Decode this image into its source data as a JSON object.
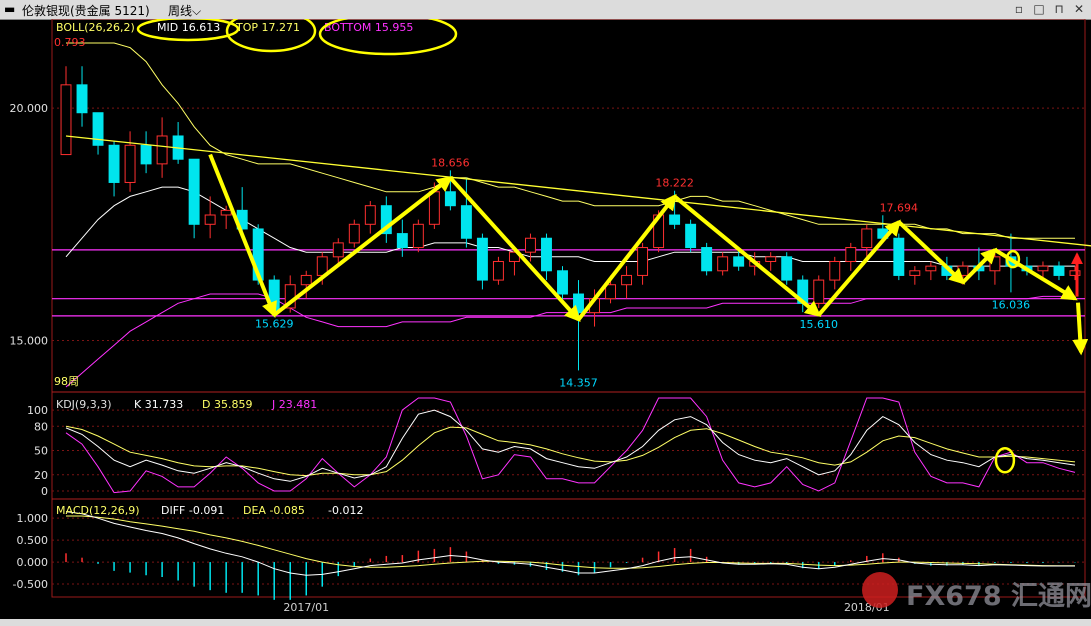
{
  "window": {
    "title": "伦敦银现(贵金属 5121)",
    "period": "周线"
  },
  "watermark": {
    "text": "FX678 汇通网"
  },
  "chart_data": {
    "type": "candlestick",
    "main": {
      "indicator_label": "BOLL(26,26,2)",
      "mid_label": "MID 16.613",
      "top_label": "TOP 17.271",
      "bottom_label": "BOTTOM 15.955",
      "y_ticks": [
        "20.000",
        "15.000"
      ],
      "y_tick_values": [
        20,
        15
      ],
      "y_range": [
        14.0,
        21.4
      ],
      "count_label": "98周",
      "edge_value": "0.793",
      "annotations": [
        {
          "text": "15.629",
          "x": 13,
          "y": 15.629,
          "side": "below",
          "color": "#00d8ff"
        },
        {
          "text": "18.656",
          "x": 24,
          "y": 18.656,
          "side": "above",
          "color": "#ff3030"
        },
        {
          "text": "14.357",
          "x": 32,
          "y": 14.357,
          "side": "below",
          "color": "#00d8ff"
        },
        {
          "text": "18.222",
          "x": 38,
          "y": 18.222,
          "side": "above",
          "color": "#ff3030"
        },
        {
          "text": "15.610",
          "x": 47,
          "y": 15.61,
          "side": "below",
          "color": "#00d8ff"
        },
        {
          "text": "17.694",
          "x": 52,
          "y": 17.694,
          "side": "above",
          "color": "#ff3030"
        },
        {
          "text": "16.036",
          "x": 59,
          "y": 16.036,
          "side": "below",
          "color": "#00d8ff"
        }
      ],
      "candles": [
        [
          19.0,
          20.9,
          19.0,
          20.5
        ],
        [
          20.5,
          20.9,
          19.6,
          19.9
        ],
        [
          19.9,
          19.9,
          19.0,
          19.2
        ],
        [
          19.2,
          19.3,
          18.1,
          18.4
        ],
        [
          18.4,
          19.5,
          18.2,
          19.2
        ],
        [
          19.2,
          19.5,
          18.6,
          18.8
        ],
        [
          18.8,
          19.8,
          18.5,
          19.4
        ],
        [
          19.4,
          19.7,
          18.8,
          18.9
        ],
        [
          18.9,
          18.9,
          17.2,
          17.5
        ],
        [
          17.5,
          18.1,
          17.2,
          17.7
        ],
        [
          17.7,
          17.9,
          17.4,
          17.8
        ],
        [
          17.8,
          18.3,
          17.2,
          17.4
        ],
        [
          17.4,
          17.5,
          16.2,
          16.3
        ],
        [
          16.3,
          16.4,
          15.5,
          15.63
        ],
        [
          15.7,
          16.4,
          15.6,
          16.2
        ],
        [
          16.2,
          16.5,
          15.9,
          16.4
        ],
        [
          16.4,
          16.9,
          16.2,
          16.8
        ],
        [
          16.8,
          17.2,
          16.6,
          17.1
        ],
        [
          17.1,
          17.6,
          17.0,
          17.5
        ],
        [
          17.5,
          18.0,
          17.3,
          17.9
        ],
        [
          17.9,
          18.1,
          17.1,
          17.3
        ],
        [
          17.3,
          17.6,
          16.8,
          17.0
        ],
        [
          17.0,
          17.6,
          16.9,
          17.5
        ],
        [
          17.5,
          18.4,
          17.4,
          18.2
        ],
        [
          18.2,
          18.66,
          17.8,
          17.9
        ],
        [
          17.9,
          18.5,
          17.0,
          17.2
        ],
        [
          17.2,
          17.3,
          16.1,
          16.3
        ],
        [
          16.3,
          16.8,
          16.2,
          16.7
        ],
        [
          16.7,
          17.0,
          16.4,
          16.9
        ],
        [
          16.9,
          17.3,
          16.7,
          17.2
        ],
        [
          17.2,
          17.3,
          16.3,
          16.5
        ],
        [
          16.5,
          16.6,
          15.8,
          16.0
        ],
        [
          16.0,
          16.3,
          14.357,
          15.6
        ],
        [
          15.6,
          16.1,
          15.3,
          15.9
        ],
        [
          15.9,
          16.4,
          15.8,
          16.2
        ],
        [
          16.2,
          16.6,
          15.9,
          16.4
        ],
        [
          16.4,
          17.1,
          16.2,
          17.0
        ],
        [
          17.0,
          17.8,
          16.9,
          17.7
        ],
        [
          17.7,
          18.222,
          17.4,
          17.5
        ],
        [
          17.5,
          17.6,
          16.9,
          17.0
        ],
        [
          17.0,
          17.1,
          16.4,
          16.5
        ],
        [
          16.5,
          16.9,
          16.4,
          16.8
        ],
        [
          16.8,
          17.0,
          16.5,
          16.6
        ],
        [
          16.6,
          16.9,
          16.4,
          16.7
        ],
        [
          16.7,
          16.9,
          16.5,
          16.8
        ],
        [
          16.8,
          16.9,
          16.2,
          16.3
        ],
        [
          16.3,
          16.4,
          15.61,
          15.8
        ],
        [
          15.8,
          16.4,
          15.7,
          16.3
        ],
        [
          16.3,
          16.8,
          16.1,
          16.7
        ],
        [
          16.7,
          17.1,
          16.5,
          17.0
        ],
        [
          17.0,
          17.5,
          16.8,
          17.4
        ],
        [
          17.4,
          17.694,
          17.1,
          17.2
        ],
        [
          17.2,
          17.3,
          16.3,
          16.4
        ],
        [
          16.4,
          16.6,
          16.2,
          16.5
        ],
        [
          16.5,
          16.7,
          16.3,
          16.6
        ],
        [
          16.6,
          16.8,
          16.3,
          16.4
        ],
        [
          16.4,
          16.7,
          16.2,
          16.6
        ],
        [
          16.6,
          17.0,
          16.3,
          16.5
        ],
        [
          16.5,
          16.9,
          16.2,
          16.8
        ],
        [
          16.8,
          17.3,
          16.036,
          16.6
        ],
        [
          16.6,
          16.8,
          16.4,
          16.5
        ],
        [
          16.5,
          16.7,
          16.3,
          16.6
        ],
        [
          16.6,
          16.7,
          16.3,
          16.4
        ],
        [
          16.4,
          16.6,
          16.3,
          16.5
        ]
      ],
      "mid_series": [
        16.8,
        17.2,
        17.6,
        17.9,
        18.1,
        18.2,
        18.3,
        18.3,
        18.2,
        18.0,
        17.8,
        17.6,
        17.4,
        17.2,
        17.0,
        16.9,
        16.9,
        16.9,
        16.9,
        16.9,
        16.9,
        17.0,
        17.0,
        17.1,
        17.1,
        17.1,
        17.0,
        17.0,
        16.9,
        16.8,
        16.8,
        16.8,
        16.8,
        16.7,
        16.7,
        16.7,
        16.7,
        16.8,
        16.9,
        16.9,
        16.9,
        16.9,
        16.9,
        16.8,
        16.8,
        16.8,
        16.7,
        16.7,
        16.7,
        16.7,
        16.7,
        16.7,
        16.7,
        16.7,
        16.7,
        16.6,
        16.6,
        16.6,
        16.6,
        16.6,
        16.6,
        16.6,
        16.6,
        16.6
      ],
      "top_series": [
        21.4,
        21.4,
        21.4,
        21.4,
        21.3,
        21.0,
        20.5,
        20.1,
        19.6,
        19.2,
        19.0,
        18.9,
        18.8,
        18.8,
        18.8,
        18.7,
        18.6,
        18.5,
        18.4,
        18.3,
        18.2,
        18.2,
        18.2,
        18.3,
        18.5,
        18.5,
        18.4,
        18.3,
        18.3,
        18.2,
        18.1,
        18.0,
        18.0,
        17.9,
        17.9,
        17.9,
        17.9,
        17.9,
        18.0,
        18.1,
        18.1,
        18.0,
        18.0,
        17.9,
        17.8,
        17.7,
        17.6,
        17.5,
        17.5,
        17.5,
        17.5,
        17.5,
        17.5,
        17.5,
        17.4,
        17.4,
        17.3,
        17.3,
        17.3,
        17.2,
        17.2,
        17.2,
        17.2,
        17.2
      ],
      "bottom_series": [
        14.0,
        14.3,
        14.6,
        14.9,
        15.2,
        15.4,
        15.6,
        15.8,
        15.9,
        16.0,
        16.0,
        16.0,
        16.0,
        15.9,
        15.7,
        15.5,
        15.4,
        15.3,
        15.3,
        15.3,
        15.3,
        15.4,
        15.4,
        15.4,
        15.4,
        15.5,
        15.5,
        15.5,
        15.5,
        15.5,
        15.6,
        15.6,
        15.6,
        15.6,
        15.6,
        15.7,
        15.7,
        15.7,
        15.7,
        15.7,
        15.7,
        15.8,
        15.8,
        15.8,
        15.8,
        15.8,
        15.8,
        15.8,
        15.8,
        15.8,
        15.9,
        15.9,
        15.9,
        15.9,
        15.9,
        15.9,
        15.9,
        15.9,
        15.9,
        15.9,
        15.9,
        15.95,
        15.95,
        15.95
      ],
      "trendline": {
        "start": [
          0,
          19.4
        ],
        "end": [
          66,
          16.95
        ]
      },
      "support_lines": [
        16.95,
        15.9,
        15.53
      ],
      "zigzag": [
        [
          9,
          19.0
        ],
        [
          13,
          15.55
        ],
        [
          24,
          18.5
        ],
        [
          32,
          15.45
        ],
        [
          38,
          18.1
        ],
        [
          47,
          15.55
        ],
        [
          52,
          17.55
        ],
        [
          56,
          16.25
        ],
        [
          58,
          16.95
        ],
        [
          63,
          15.9
        ]
      ]
    },
    "kdj": {
      "label": "KDJ(9,3,3)",
      "k_label": "K 31.733",
      "d_label": "D 35.859",
      "j_label": "J 23.481",
      "y_ticks": [
        "100",
        "80",
        "50",
        "20",
        "0"
      ],
      "y_tick_values": [
        100,
        80,
        50,
        20,
        0
      ],
      "y_range": [
        -5,
        115
      ],
      "k": [
        78,
        70,
        55,
        38,
        30,
        38,
        32,
        25,
        22,
        28,
        35,
        30,
        22,
        15,
        12,
        18,
        28,
        22,
        16,
        20,
        30,
        65,
        95,
        100,
        92,
        75,
        52,
        48,
        55,
        52,
        40,
        35,
        30,
        28,
        35,
        42,
        55,
        75,
        88,
        92,
        82,
        60,
        45,
        38,
        35,
        40,
        30,
        20,
        25,
        45,
        75,
        92,
        82,
        60,
        45,
        38,
        35,
        30,
        42,
        45,
        40,
        38,
        35,
        32
      ],
      "d": [
        80,
        76,
        68,
        58,
        48,
        44,
        40,
        35,
        31,
        30,
        31,
        31,
        28,
        24,
        20,
        19,
        22,
        22,
        20,
        20,
        24,
        38,
        56,
        72,
        79,
        78,
        70,
        62,
        60,
        57,
        52,
        46,
        41,
        37,
        36,
        38,
        44,
        54,
        66,
        75,
        77,
        71,
        63,
        55,
        48,
        45,
        41,
        35,
        32,
        36,
        48,
        62,
        68,
        66,
        59,
        52,
        47,
        42,
        42,
        43,
        42,
        40,
        38,
        36
      ],
      "j": [
        72,
        58,
        30,
        -2,
        0,
        25,
        18,
        5,
        5,
        22,
        42,
        28,
        10,
        0,
        0,
        15,
        40,
        22,
        5,
        20,
        42,
        100,
        115,
        115,
        110,
        68,
        15,
        20,
        45,
        42,
        15,
        15,
        10,
        10,
        30,
        50,
        75,
        115,
        115,
        115,
        92,
        38,
        10,
        5,
        10,
        30,
        8,
        0,
        10,
        62,
        115,
        115,
        110,
        48,
        18,
        10,
        10,
        5,
        42,
        48,
        35,
        35,
        28,
        23
      ]
    },
    "macd": {
      "label": "MACD(12,26,9)",
      "diff_label": "DIFF -0.091",
      "dea_label": "DEA -0.085",
      "macd_label": "-0.012",
      "y_ticks": [
        "1.000",
        "0.500",
        "0.000",
        "-0.500"
      ],
      "y_tick_values": [
        1.0,
        0.5,
        0.0,
        -0.5
      ],
      "y_range": [
        -0.75,
        1.3
      ],
      "diff": [
        1.15,
        1.1,
        1.0,
        0.88,
        0.8,
        0.72,
        0.65,
        0.55,
        0.42,
        0.3,
        0.2,
        0.12,
        0.0,
        -0.15,
        -0.25,
        -0.3,
        -0.28,
        -0.22,
        -0.15,
        -0.08,
        -0.05,
        -0.02,
        0.05,
        0.1,
        0.15,
        0.12,
        0.05,
        0.0,
        -0.02,
        -0.05,
        -0.12,
        -0.18,
        -0.25,
        -0.25,
        -0.2,
        -0.15,
        -0.08,
        0.02,
        0.1,
        0.12,
        0.05,
        -0.02,
        -0.05,
        -0.05,
        -0.04,
        -0.05,
        -0.12,
        -0.15,
        -0.12,
        -0.05,
        0.02,
        0.08,
        0.05,
        -0.02,
        -0.05,
        -0.06,
        -0.06,
        -0.08,
        -0.06,
        -0.07,
        -0.08,
        -0.09,
        -0.09,
        -0.09
      ],
      "dea": [
        1.05,
        1.05,
        1.02,
        0.98,
        0.92,
        0.87,
        0.82,
        0.76,
        0.7,
        0.62,
        0.55,
        0.47,
        0.38,
        0.28,
        0.18,
        0.08,
        0.0,
        -0.06,
        -0.1,
        -0.12,
        -0.12,
        -0.1,
        -0.08,
        -0.05,
        -0.02,
        0.0,
        0.02,
        0.02,
        0.01,
        0.0,
        -0.03,
        -0.07,
        -0.1,
        -0.13,
        -0.14,
        -0.14,
        -0.13,
        -0.1,
        -0.06,
        -0.03,
        -0.01,
        -0.01,
        -0.02,
        -0.03,
        -0.03,
        -0.03,
        -0.05,
        -0.07,
        -0.08,
        -0.07,
        -0.05,
        -0.02,
        0.0,
        0.0,
        -0.01,
        -0.02,
        -0.03,
        -0.04,
        -0.05,
        -0.06,
        -0.07,
        -0.08,
        -0.085,
        -0.085
      ]
    },
    "x_labels": [
      {
        "text": "2017/01",
        "index": 15
      },
      {
        "text": "2018/01",
        "index": 50
      }
    ],
    "colors": {
      "up": "#ff3030",
      "down": "#00e5ee",
      "mid": "#ffffff",
      "top": "#ffff66",
      "bottom": "#ff33ff",
      "trend": "#ffff33",
      "support": "#ff33ff",
      "arrow": "#ffff00",
      "k": "#ffffff",
      "d": "#ffff66",
      "j": "#ff33ff",
      "grid": "#7a1414",
      "red_arrow": "#ff2020"
    }
  }
}
